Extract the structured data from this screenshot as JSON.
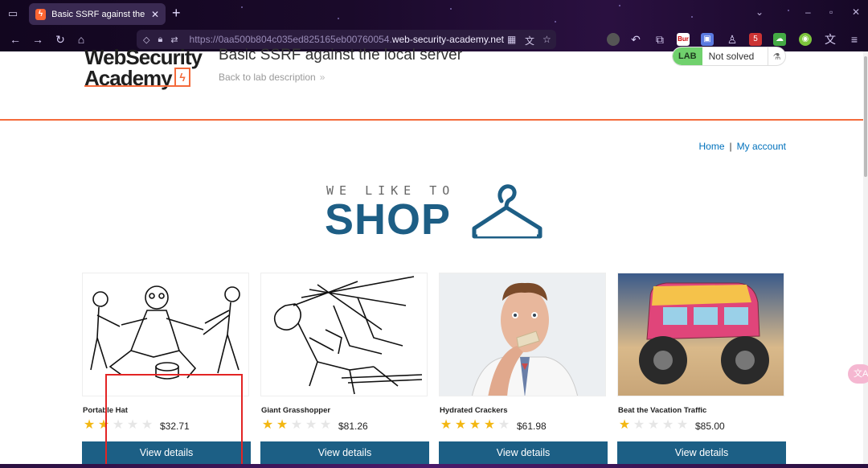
{
  "browser": {
    "tab_title": "Basic SSRF against the local s",
    "tab_favicon": "ϟ",
    "new_tab_glyph": "+",
    "url_prefix": "https://",
    "url_subdomain": "0aa500b804c035ed825165eb00760054.",
    "url_domain": "web-security-academy.net",
    "icons": [
      "tab-list-icon",
      "close-icon",
      "new-tab-icon",
      "back-icon",
      "forward-icon",
      "reload-icon",
      "home-icon",
      "shield-icon",
      "lock-icon",
      "permissions-icon",
      "qr-icon",
      "translate-icon",
      "bookmark-star-icon",
      "extensions-icon",
      "menu-icon"
    ],
    "ext_badge": "5",
    "ext_burp": "Bur"
  },
  "lab": {
    "logo_line1": "WebSecurity",
    "logo_line2": "Academy",
    "logo_mark": "ϟ",
    "title": "Basic SSRF against the local server",
    "back_link": "Back to lab description",
    "back_chevron": "»",
    "status_badge": "LAB",
    "status_text": "Not solved",
    "status_icon": "⚗"
  },
  "nav": {
    "home": "Home",
    "separator": "|",
    "account": "My account"
  },
  "banner": {
    "small": "WE LIKE TO",
    "big": "SHOP"
  },
  "products": [
    {
      "name": "Portable Hat",
      "stars": 2,
      "price": "$32.71",
      "button": "View details"
    },
    {
      "name": "Giant Grasshopper",
      "stars": 2,
      "price": "$81.26",
      "button": "View details"
    },
    {
      "name": "Hydrated Crackers",
      "stars": 4,
      "price": "$61.98",
      "button": "View details"
    },
    {
      "name": "Beat the Vacation Traffic",
      "stars": 1,
      "price": "$85.00",
      "button": "View details"
    }
  ],
  "translate_fab": "文A"
}
